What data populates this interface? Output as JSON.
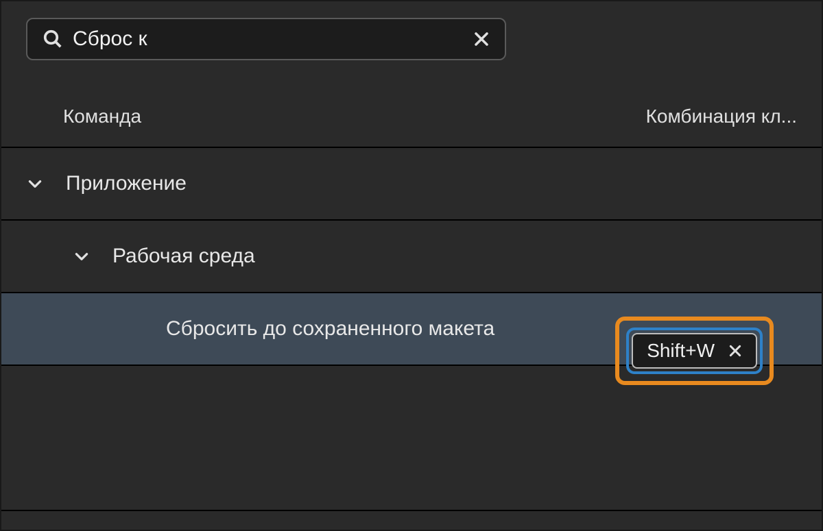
{
  "search": {
    "value": "Сброс к"
  },
  "columns": {
    "command": "Команда",
    "shortcut": "Комбинация кл..."
  },
  "tree": {
    "app": {
      "label": "Приложение",
      "workspace": {
        "label": "Рабочая среда",
        "reset_saved": {
          "label": "Сбросить до сохраненного макета",
          "shortcut": "Shift+W"
        }
      }
    }
  }
}
